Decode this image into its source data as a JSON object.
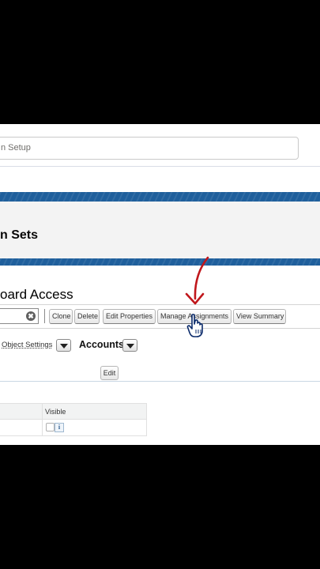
{
  "setup_search": {
    "placeholder": "n Setup"
  },
  "page_title": "n Sets",
  "section_title": "oard Access",
  "toolbar": {
    "clear_icon": "✖",
    "buttons": [
      "Clone",
      "Delete",
      "Edit Properties",
      "Manage Assignments",
      "View Summary"
    ]
  },
  "object_settings": {
    "link_label": "Object Settings",
    "selected_object": "Accounts"
  },
  "edit_label": "Edit",
  "table": {
    "header": "Visible",
    "info_glyph": "i"
  },
  "annotation": {
    "arrow_color": "#c0171c",
    "cursor": "hand-pointer-icon"
  }
}
